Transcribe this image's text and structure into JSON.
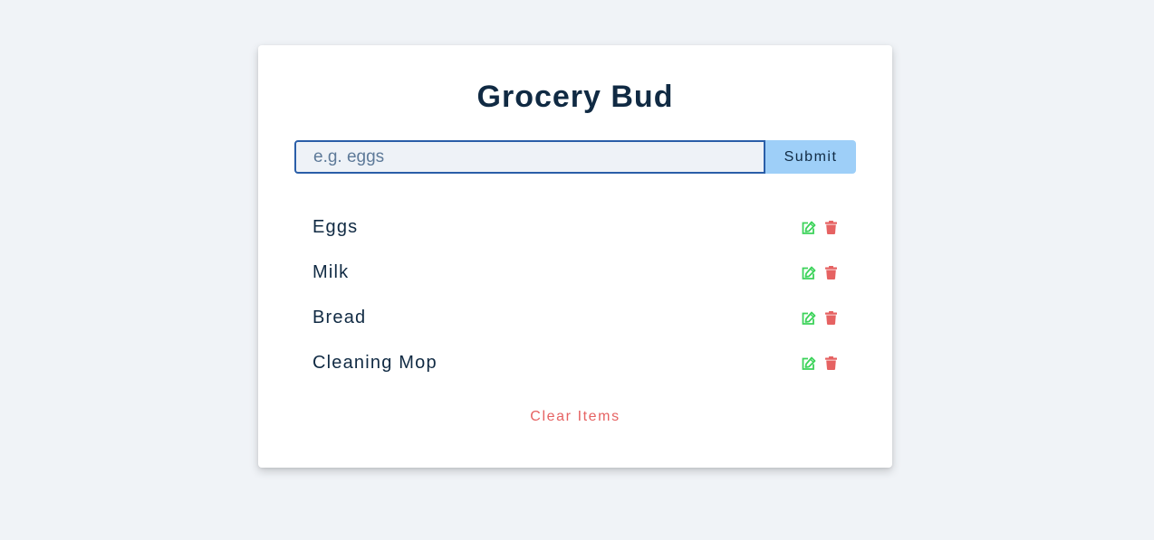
{
  "app": {
    "title": "Grocery Bud"
  },
  "form": {
    "input_value": "",
    "placeholder": "e.g. eggs",
    "submit_label": "Submit"
  },
  "items": [
    {
      "name": "Eggs"
    },
    {
      "name": "Milk"
    },
    {
      "name": "Bread"
    },
    {
      "name": "Cleaning Mop"
    }
  ],
  "actions": {
    "clear_label": "Clear Items"
  },
  "icons": {
    "edit": "edit-icon",
    "delete": "trash-icon"
  },
  "colors": {
    "background": "#f0f3f7",
    "card": "#ffffff",
    "title": "#102a43",
    "input_border": "#2a5ea8",
    "submit_bg": "#9ecff8",
    "edit_icon": "#3cd35a",
    "delete_icon": "#e66262",
    "clear_text": "#e66262"
  }
}
